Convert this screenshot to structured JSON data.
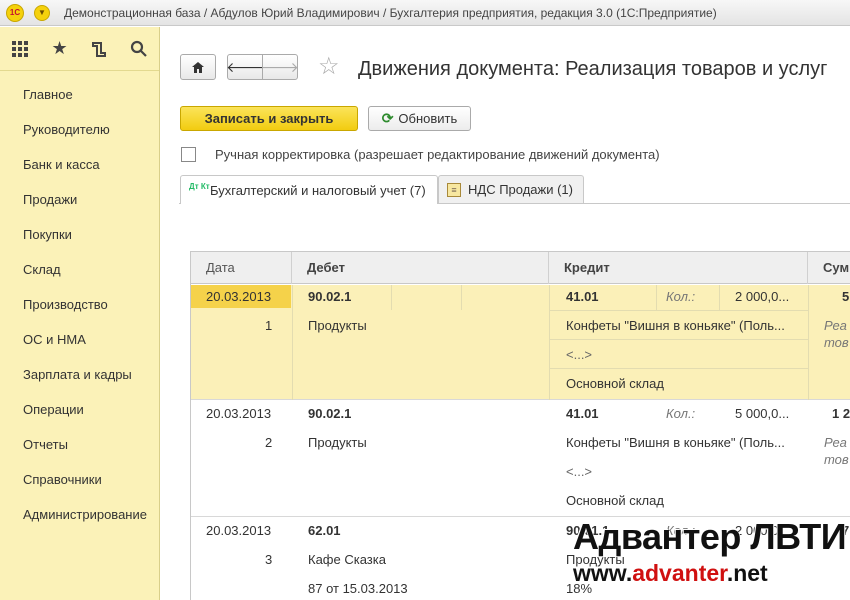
{
  "window": {
    "title": "Демонстрационная база / Абдулов Юрий Владимирович / Бухгалтерия предприятия, редакция 3.0 (1С:Предприятие)",
    "logo_text": "1С"
  },
  "sidebar": {
    "tools": [
      {
        "icon": "grid-icon",
        "glyph": "⋮⋮⋮"
      },
      {
        "icon": "star-icon",
        "glyph": "★"
      },
      {
        "icon": "history-icon",
        "glyph": "⧉"
      },
      {
        "icon": "search-icon",
        "glyph": "⚲"
      }
    ],
    "items": [
      {
        "label": "Главное"
      },
      {
        "label": "Руководителю"
      },
      {
        "label": "Банк и касса"
      },
      {
        "label": "Продажи"
      },
      {
        "label": "Покупки"
      },
      {
        "label": "Склад"
      },
      {
        "label": "Производство"
      },
      {
        "label": "ОС и НМА"
      },
      {
        "label": "Зарплата и кадры"
      },
      {
        "label": "Операции"
      },
      {
        "label": "Отчеты"
      },
      {
        "label": "Справочники"
      },
      {
        "label": "Администрирование"
      }
    ]
  },
  "document": {
    "title": "Движения документа: Реализация товаров и услуг",
    "save_label": "Записать и закрыть",
    "refresh_label": "Обновить",
    "manual_correction_label": "Ручная корректировка (разрешает редактирование движений документа)",
    "manual_correction_checked": false
  },
  "tabs": [
    {
      "label": "Бухгалтерский и налоговый учет (7)",
      "active": true,
      "icon": "accounting-icon",
      "icon_text": "Дт Кт"
    },
    {
      "label": "НДС Продажи (1)",
      "active": false,
      "icon": "vat-register-icon",
      "icon_text": "≡"
    }
  ],
  "table": {
    "headers": {
      "date": "Дата",
      "debit": "Дебет",
      "credit": "Кредит",
      "sum": "Сум"
    },
    "rows": [
      {
        "date": "20.03.2013",
        "num": "1",
        "debit_account": "90.02.1",
        "debit_sub1": "Продукты",
        "credit_account": "41.01",
        "qty_label": "Кол.:",
        "qty_value": "2 000,0...",
        "credit_sub1": "Конфеты \"Вишня в коньяке\" (Поль...",
        "credit_sub2": "<...>",
        "credit_sub3": "Основной склад",
        "sum": "5",
        "sum_note1": "Реа",
        "sum_note2": "тов"
      },
      {
        "date": "20.03.2013",
        "num": "2",
        "debit_account": "90.02.1",
        "debit_sub1": "Продукты",
        "credit_account": "41.01",
        "qty_label": "Кол.:",
        "qty_value": "5 000,0...",
        "credit_sub1": "Конфеты \"Вишня в коньяке\" (Поль...",
        "credit_sub2": "<...>",
        "credit_sub3": "Основной склад",
        "sum": "1 2",
        "sum_note1": "Реа",
        "sum_note2": "тов"
      },
      {
        "date": "20.03.2013",
        "num": "3",
        "debit_account": "62.01",
        "debit_sub1": "Кафе Сказка",
        "debit_sub2": "87 от 15.03.2013",
        "credit_account": "90.01.1",
        "qty_label": "Кол.:",
        "qty_value": "2 000,0...",
        "credit_sub1": "Продукты",
        "credit_sub2": "18%",
        "sum": "7"
      }
    ]
  },
  "watermark": {
    "line1": "Адвантер ЛВТИ",
    "line2_pre": "www.",
    "line2_red": "advanter",
    "line2_post": ".net"
  }
}
